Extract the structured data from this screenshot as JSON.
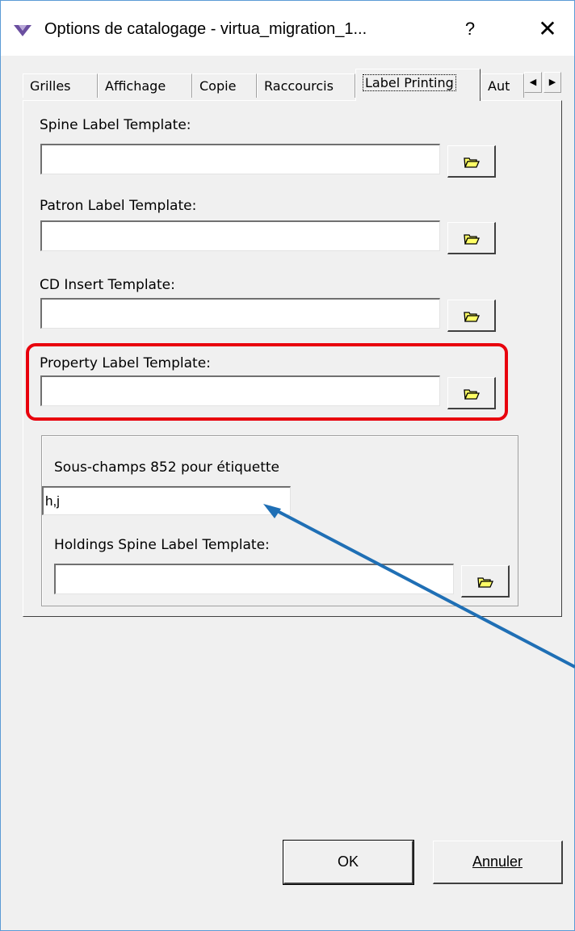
{
  "window": {
    "title": "Options de catalogage - virtua_migration_1...",
    "help_label": "?",
    "close_label": "✕"
  },
  "tabs": [
    {
      "label": "Grilles"
    },
    {
      "label": "Affichage"
    },
    {
      "label": "Copie"
    },
    {
      "label": "Raccourcis"
    },
    {
      "label": "Label Printing",
      "active": true
    },
    {
      "label": "Aut"
    }
  ],
  "tab_scroll": {
    "left": "◀",
    "right": "▶"
  },
  "fields": {
    "spine": {
      "label": "Spine Label Template:",
      "value": ""
    },
    "patron": {
      "label": "Patron Label Template:",
      "value": ""
    },
    "cd_insert": {
      "label": "CD Insert Template:",
      "value": ""
    },
    "property": {
      "label": "Property Label Template:",
      "value": ""
    }
  },
  "group": {
    "subfield_label": "Sous-champs 852 pour étiquette",
    "subfield_value": "h,j",
    "holdings_label": "Holdings Spine Label Template:",
    "holdings_value": ""
  },
  "buttons": {
    "ok": "OK",
    "cancel": "Annuler"
  },
  "icons": {
    "folder": "folder-open-icon",
    "app": "app-logo-icon"
  },
  "colors": {
    "highlight": "#e8000d",
    "annotation_arrow": "#1f6fb5",
    "folder": "#ffff66"
  }
}
